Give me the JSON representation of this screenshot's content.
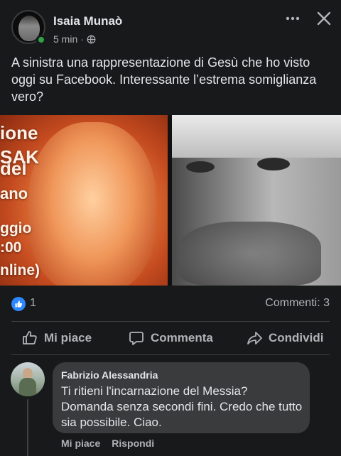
{
  "post": {
    "author": "Isaia Munaò",
    "time": "5 min",
    "separator": "·",
    "text": "A sinistra una rappresentazione di Gesù che ho visto oggi su Facebook. Interessante l’estrema somiglianza vero?",
    "image_overlay_lines": [
      "ione del",
      "SAK",
      "ano",
      "ggio",
      ":00",
      "nline)"
    ]
  },
  "reactions": {
    "like_count": "1",
    "comments": "Commenti: 3"
  },
  "actions": {
    "like": "Mi piace",
    "comment": "Commenta",
    "share": "Condividi"
  },
  "comment": {
    "author": "Fabrizio Alessandria",
    "text": "Ti ritieni l'incarnazione del Messia? Domanda senza secondi fini. Credo che tutto sia possibile. Ciao.",
    "like_action": "Mi piace",
    "reply_action": "Rispondi"
  },
  "colors": {
    "background": "#18191a",
    "text": "#e4e6eb",
    "secondary": "#b0b3b8",
    "bubble": "#3a3b3c",
    "like_blue": "#2d88ff",
    "online_green": "#31a24c"
  },
  "icons": [
    "more-icon",
    "close-icon",
    "globe-icon",
    "like-reaction-icon",
    "thumbs-up-icon",
    "comment-icon",
    "share-icon"
  ]
}
